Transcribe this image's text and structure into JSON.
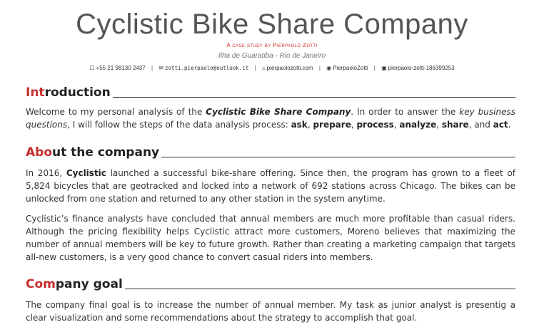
{
  "header": {
    "title": "Cyclistic Bike Share Company",
    "subtitle": "A case study by Pierpaolo Zotti",
    "location": "Ilha de Guaratiba - Rio de Janeiro",
    "contacts": {
      "phone": "+55 21 98130 2437",
      "email": "zotti.pierpaolo@outlook.it",
      "website": "pierpaolozotti.com",
      "github": "PierpaoloZotti",
      "linkedin": "pierpaolo-zotti-186399253"
    }
  },
  "sections": {
    "intro": {
      "heading_accent": "Int",
      "heading_rest": "roduction",
      "p1": {
        "t1": "Welcome to my personal analysis of the ",
        "company": "Cyclistic Bike Share Company",
        "t2": ". In order to answer the ",
        "kbq": "key business questions",
        "t3": ", I will follow the steps of the data analysis process: ",
        "ask": "ask",
        "c1": ", ",
        "prepare": "prepare",
        "c2": ", ",
        "process": "process",
        "c3": ", ",
        "analyze": "analyze",
        "c4": ", ",
        "share": "share",
        "t4": ", and ",
        "act": "act",
        "t5": "."
      }
    },
    "about": {
      "heading_accent": "Abo",
      "heading_rest": "ut the company",
      "p1": {
        "t1": "In 2016, ",
        "cyclistic": "Cyclistic",
        "t2": " launched a successful bike-share offering. Since then, the program has grown to a fleet of 5,824 bicycles that are geotracked and locked into a network of 692 stations across Chicago. The bikes can be unlocked from one station and returned to any other station in the system anytime."
      },
      "p2": "Cyclistic’s finance analysts have concluded that annual members are much more profitable than casual riders. Although the pricing flexibility helps Cyclistic attract more customers, Moreno believes that maximizing the number of annual members will be key to future growth. Rather than creating a marketing campaign that targets all-new customers, is a very good chance to convert casual riders into members."
    },
    "goal": {
      "heading_accent": "Com",
      "heading_rest": "pany goal",
      "p1": "The company final goal is to increase the number of annual member. My task as junior analyst is presentig a clear visualization and some recommendations about the strategy to accomplish that goal."
    }
  },
  "colors": {
    "accent": "#c62d2d",
    "text": "#333333",
    "title": "#555555"
  },
  "icons": [
    "phone-icon",
    "envelope-icon",
    "home-icon",
    "github-icon",
    "linkedin-icon"
  ]
}
